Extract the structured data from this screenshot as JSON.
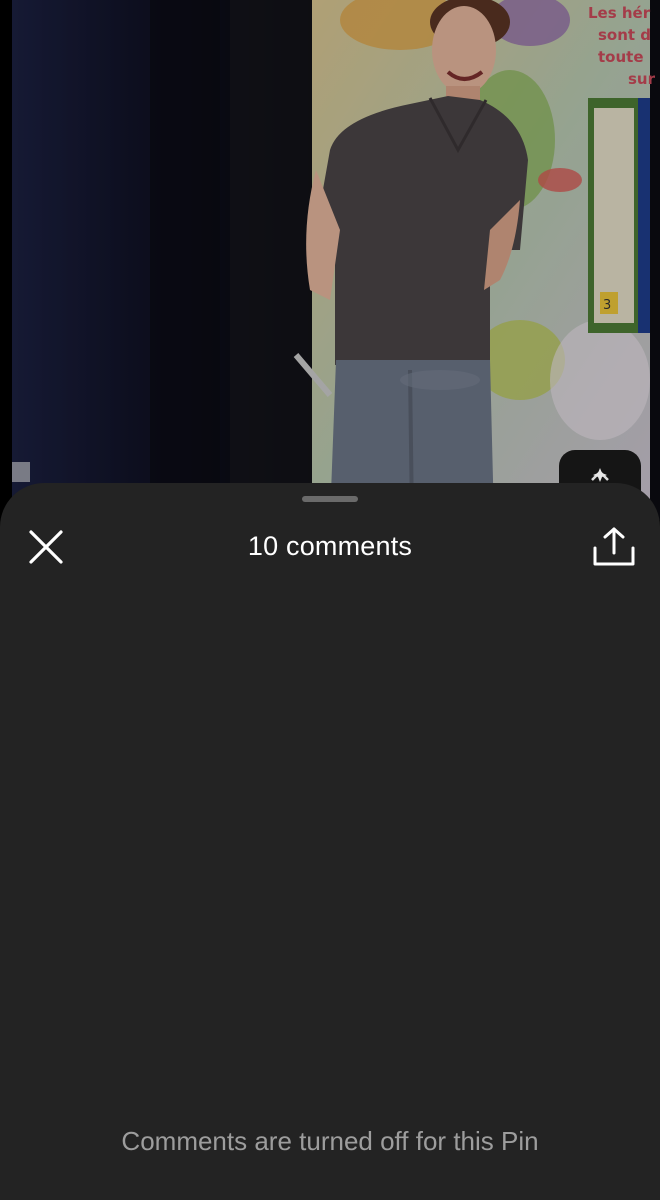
{
  "sheet": {
    "title": "10 comments",
    "empty_message": "Comments are turned off for this Pin"
  },
  "photo": {
    "poster_text_lines": [
      "Les hér",
      "sont d",
      "toute",
      "sur"
    ],
    "box_label": "3"
  },
  "icons": {
    "close": "close-icon",
    "share": "share-icon",
    "lens": "visual-search-icon"
  },
  "colors": {
    "sheet_background": "#232323",
    "title_text": "#ffffff",
    "muted_text": "#9d9d9d"
  }
}
